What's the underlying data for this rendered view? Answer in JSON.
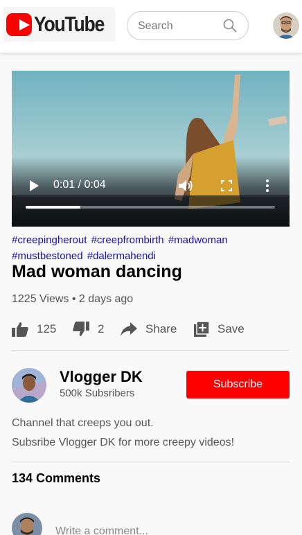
{
  "header": {
    "logo_text": "YouTube",
    "search_placeholder": "Search"
  },
  "video": {
    "time": "0:01 / 0:04",
    "progress": 0.22
  },
  "tags": [
    "#creepingherout",
    "#creepfrombirth",
    "#madwoman",
    "#mustbestoned",
    "#dalermahendi"
  ],
  "title": "Mad woman dancing",
  "meta": "1225 Views • 2 days ago",
  "actions": {
    "likes": "125",
    "dislikes": "2",
    "share_label": "Share",
    "save_label": "Save"
  },
  "channel": {
    "name": "Vlogger DK",
    "subscribers": "500k Subsribers",
    "subscribe_label": "Subscribe",
    "description_lines": [
      "Channel that creeps you out.",
      "Subsribe Vlogger DK for more creepy videos!"
    ]
  },
  "comments": {
    "heading": "134 Comments",
    "placeholder": "Write a comment..."
  },
  "icons": {
    "like": "thumbs-up-icon",
    "dislike": "thumbs-down-icon",
    "share": "share-arrow-icon",
    "save": "playlist-add-icon",
    "search": "search-icon"
  },
  "colors": {
    "brand": "#ff0000",
    "link": "#1a0dab"
  }
}
